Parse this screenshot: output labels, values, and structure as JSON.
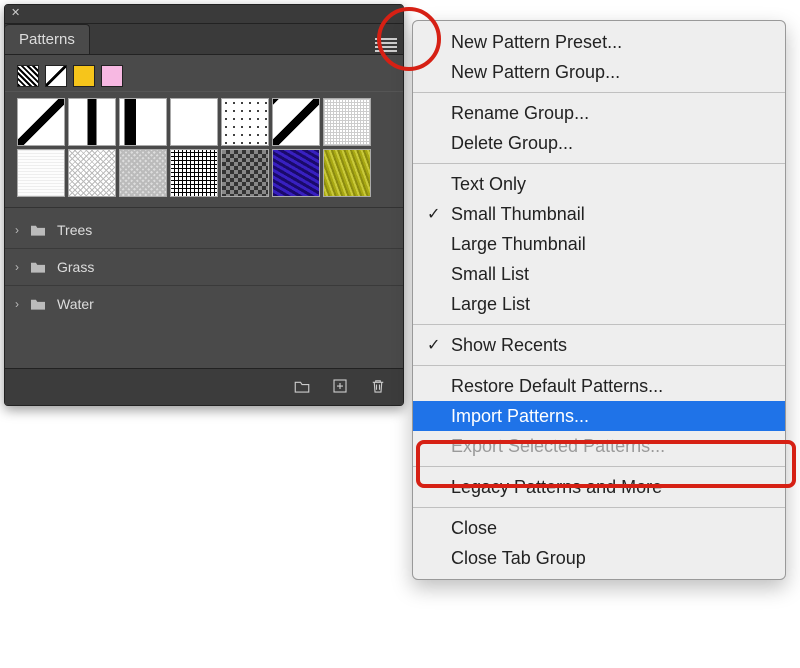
{
  "panel": {
    "tab_label": "Patterns",
    "folders": [
      {
        "name": "Trees"
      },
      {
        "name": "Grass"
      },
      {
        "name": "Water"
      }
    ]
  },
  "menu": {
    "items": [
      {
        "label": "New Pattern Preset...",
        "enabled": true
      },
      {
        "label": "New Pattern Group...",
        "enabled": true
      },
      {
        "sep": true
      },
      {
        "label": "Rename Group...",
        "enabled": true
      },
      {
        "label": "Delete Group...",
        "enabled": true
      },
      {
        "sep": true
      },
      {
        "label": "Text Only",
        "enabled": true
      },
      {
        "label": "Small Thumbnail",
        "enabled": true,
        "checked": true
      },
      {
        "label": "Large Thumbnail",
        "enabled": true
      },
      {
        "label": "Small List",
        "enabled": true
      },
      {
        "label": "Large List",
        "enabled": true
      },
      {
        "sep": true
      },
      {
        "label": "Show Recents",
        "enabled": true,
        "checked": true
      },
      {
        "sep": true
      },
      {
        "label": "Restore Default Patterns...",
        "enabled": true
      },
      {
        "label": "Import Patterns...",
        "enabled": true,
        "selected": true
      },
      {
        "label": "Export Selected Patterns...",
        "enabled": false
      },
      {
        "sep": true
      },
      {
        "label": "Legacy Patterns and More",
        "enabled": true
      },
      {
        "sep": true
      },
      {
        "label": "Close",
        "enabled": true
      },
      {
        "label": "Close Tab Group",
        "enabled": true
      }
    ]
  }
}
